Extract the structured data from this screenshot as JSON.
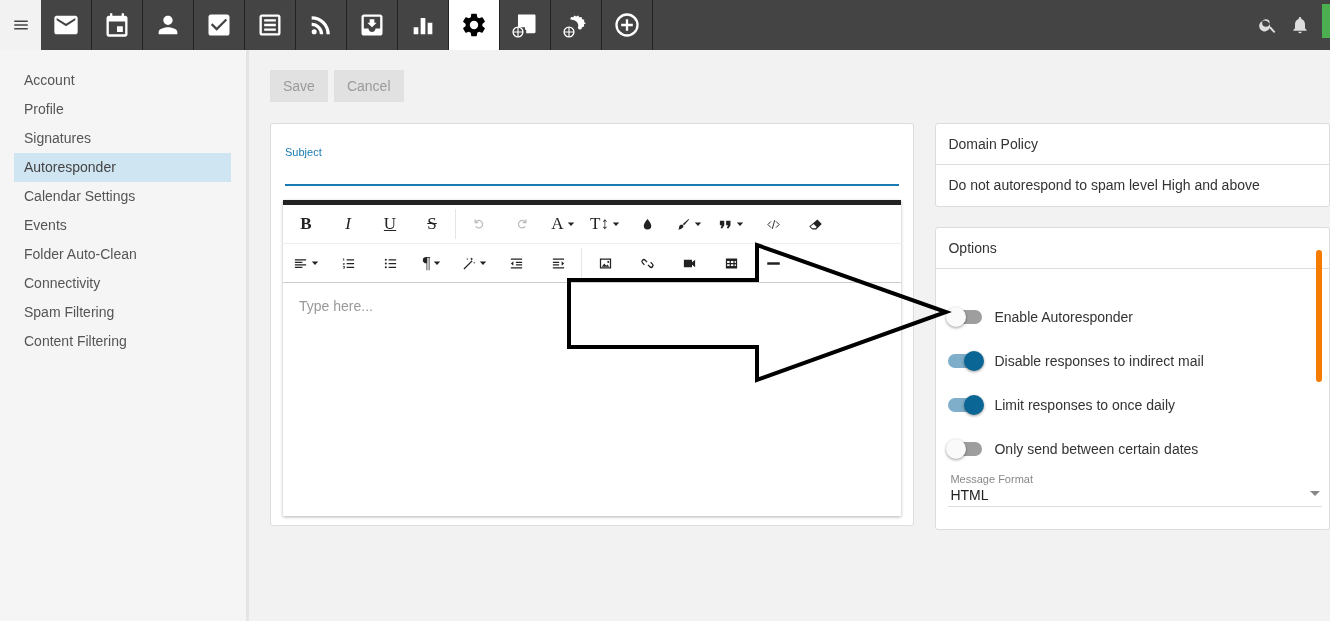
{
  "top_nav": {
    "items": [
      {
        "kind": "mail",
        "selected": false
      },
      {
        "kind": "calendar",
        "selected": false
      },
      {
        "kind": "contacts",
        "selected": false
      },
      {
        "kind": "tasks",
        "selected": false
      },
      {
        "kind": "notes",
        "selected": false
      },
      {
        "kind": "rss",
        "selected": false
      },
      {
        "kind": "inbox",
        "selected": false
      },
      {
        "kind": "stats",
        "selected": false
      },
      {
        "kind": "settings",
        "selected": true
      },
      {
        "kind": "domain-stats",
        "selected": false
      },
      {
        "kind": "domain-settings",
        "selected": false
      },
      {
        "kind": "add",
        "selected": false
      }
    ]
  },
  "sidebar": {
    "items": [
      {
        "label": "Account",
        "selected": false
      },
      {
        "label": "Profile",
        "selected": false
      },
      {
        "label": "Signatures",
        "selected": false
      },
      {
        "label": "Autoresponder",
        "selected": true
      },
      {
        "label": "Calendar Settings",
        "selected": false
      },
      {
        "label": "Events",
        "selected": false
      },
      {
        "label": "Folder Auto-Clean",
        "selected": false
      },
      {
        "label": "Connectivity",
        "selected": false
      },
      {
        "label": "Spam Filtering",
        "selected": false
      },
      {
        "label": "Content Filtering",
        "selected": false
      }
    ]
  },
  "actions": [
    {
      "label": "Save",
      "disabled": true
    },
    {
      "label": "Cancel",
      "disabled": true
    }
  ],
  "subject": {
    "label": "Subject"
  },
  "editor_toolbar": {
    "rows": [
      [
        {
          "kind": "bold",
          "label": "B",
          "dropdown": false,
          "disabled": false
        },
        {
          "kind": "italic",
          "label": "I",
          "dropdown": false,
          "disabled": false
        },
        {
          "kind": "underline",
          "label": "U",
          "dropdown": false,
          "disabled": false
        },
        {
          "kind": "strike",
          "label": "S",
          "dropdown": false,
          "disabled": false
        },
        {
          "kind": "separator"
        },
        {
          "kind": "undo",
          "dropdown": false,
          "disabled": true
        },
        {
          "kind": "redo",
          "dropdown": false,
          "disabled": true
        },
        {
          "kind": "font",
          "label": "A",
          "dropdown": true,
          "disabled": false
        },
        {
          "kind": "size",
          "label": "T↕",
          "dropdown": true,
          "disabled": false
        },
        {
          "kind": "color",
          "dropdown": false,
          "disabled": false
        },
        {
          "kind": "brush",
          "dropdown": true,
          "disabled": false
        },
        {
          "kind": "quote",
          "dropdown": true,
          "disabled": false
        },
        {
          "kind": "code",
          "dropdown": false,
          "disabled": false
        },
        {
          "kind": "eraser",
          "dropdown": false,
          "disabled": false
        }
      ],
      [
        {
          "kind": "align",
          "dropdown": true,
          "disabled": false
        },
        {
          "kind": "ordered-list",
          "dropdown": false,
          "disabled": false
        },
        {
          "kind": "bullet-list",
          "dropdown": false,
          "disabled": false
        },
        {
          "kind": "paragraph",
          "label": "¶",
          "dropdown": true,
          "disabled": false
        },
        {
          "kind": "wand",
          "dropdown": true,
          "disabled": false
        },
        {
          "kind": "outdent",
          "dropdown": false,
          "disabled": false
        },
        {
          "kind": "indent",
          "dropdown": false,
          "disabled": false
        },
        {
          "kind": "separator"
        },
        {
          "kind": "image",
          "dropdown": false,
          "disabled": false
        },
        {
          "kind": "link",
          "dropdown": false,
          "disabled": false
        },
        {
          "kind": "video",
          "dropdown": false,
          "disabled": false
        },
        {
          "kind": "table",
          "dropdown": false,
          "disabled": false
        },
        {
          "kind": "rule",
          "dropdown": false,
          "disabled": false
        }
      ]
    ]
  },
  "editor": {
    "placeholder": "Type here..."
  },
  "domain_policy": {
    "title": "Domain Policy",
    "text": "Do not autorespond to spam level High and above"
  },
  "options": {
    "title": "Options",
    "toggles": [
      {
        "label": "Enable Autoresponder",
        "on": false
      },
      {
        "label": "Disable responses to indirect mail",
        "on": true
      },
      {
        "label": "Limit responses to once daily",
        "on": true
      },
      {
        "label": "Only send between certain dates",
        "on": false
      }
    ],
    "message_format": {
      "label": "Message Format",
      "value": "HTML"
    }
  }
}
